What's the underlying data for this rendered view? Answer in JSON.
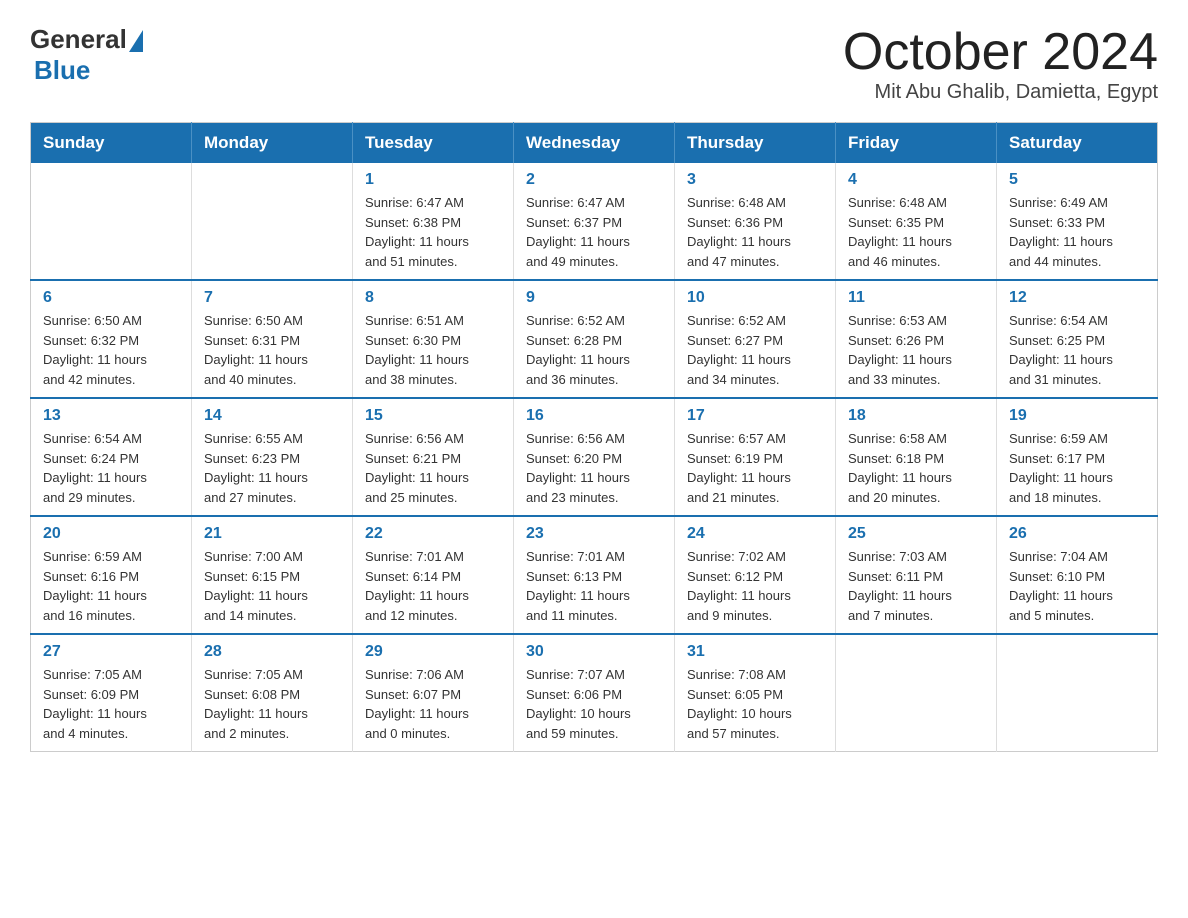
{
  "logo": {
    "general": "General",
    "blue": "Blue"
  },
  "header": {
    "month": "October 2024",
    "location": "Mit Abu Ghalib, Damietta, Egypt"
  },
  "weekdays": [
    "Sunday",
    "Monday",
    "Tuesday",
    "Wednesday",
    "Thursday",
    "Friday",
    "Saturday"
  ],
  "weeks": [
    [
      {
        "day": "",
        "info": ""
      },
      {
        "day": "",
        "info": ""
      },
      {
        "day": "1",
        "info": "Sunrise: 6:47 AM\nSunset: 6:38 PM\nDaylight: 11 hours\nand 51 minutes."
      },
      {
        "day": "2",
        "info": "Sunrise: 6:47 AM\nSunset: 6:37 PM\nDaylight: 11 hours\nand 49 minutes."
      },
      {
        "day": "3",
        "info": "Sunrise: 6:48 AM\nSunset: 6:36 PM\nDaylight: 11 hours\nand 47 minutes."
      },
      {
        "day": "4",
        "info": "Sunrise: 6:48 AM\nSunset: 6:35 PM\nDaylight: 11 hours\nand 46 minutes."
      },
      {
        "day": "5",
        "info": "Sunrise: 6:49 AM\nSunset: 6:33 PM\nDaylight: 11 hours\nand 44 minutes."
      }
    ],
    [
      {
        "day": "6",
        "info": "Sunrise: 6:50 AM\nSunset: 6:32 PM\nDaylight: 11 hours\nand 42 minutes."
      },
      {
        "day": "7",
        "info": "Sunrise: 6:50 AM\nSunset: 6:31 PM\nDaylight: 11 hours\nand 40 minutes."
      },
      {
        "day": "8",
        "info": "Sunrise: 6:51 AM\nSunset: 6:30 PM\nDaylight: 11 hours\nand 38 minutes."
      },
      {
        "day": "9",
        "info": "Sunrise: 6:52 AM\nSunset: 6:28 PM\nDaylight: 11 hours\nand 36 minutes."
      },
      {
        "day": "10",
        "info": "Sunrise: 6:52 AM\nSunset: 6:27 PM\nDaylight: 11 hours\nand 34 minutes."
      },
      {
        "day": "11",
        "info": "Sunrise: 6:53 AM\nSunset: 6:26 PM\nDaylight: 11 hours\nand 33 minutes."
      },
      {
        "day": "12",
        "info": "Sunrise: 6:54 AM\nSunset: 6:25 PM\nDaylight: 11 hours\nand 31 minutes."
      }
    ],
    [
      {
        "day": "13",
        "info": "Sunrise: 6:54 AM\nSunset: 6:24 PM\nDaylight: 11 hours\nand 29 minutes."
      },
      {
        "day": "14",
        "info": "Sunrise: 6:55 AM\nSunset: 6:23 PM\nDaylight: 11 hours\nand 27 minutes."
      },
      {
        "day": "15",
        "info": "Sunrise: 6:56 AM\nSunset: 6:21 PM\nDaylight: 11 hours\nand 25 minutes."
      },
      {
        "day": "16",
        "info": "Sunrise: 6:56 AM\nSunset: 6:20 PM\nDaylight: 11 hours\nand 23 minutes."
      },
      {
        "day": "17",
        "info": "Sunrise: 6:57 AM\nSunset: 6:19 PM\nDaylight: 11 hours\nand 21 minutes."
      },
      {
        "day": "18",
        "info": "Sunrise: 6:58 AM\nSunset: 6:18 PM\nDaylight: 11 hours\nand 20 minutes."
      },
      {
        "day": "19",
        "info": "Sunrise: 6:59 AM\nSunset: 6:17 PM\nDaylight: 11 hours\nand 18 minutes."
      }
    ],
    [
      {
        "day": "20",
        "info": "Sunrise: 6:59 AM\nSunset: 6:16 PM\nDaylight: 11 hours\nand 16 minutes."
      },
      {
        "day": "21",
        "info": "Sunrise: 7:00 AM\nSunset: 6:15 PM\nDaylight: 11 hours\nand 14 minutes."
      },
      {
        "day": "22",
        "info": "Sunrise: 7:01 AM\nSunset: 6:14 PM\nDaylight: 11 hours\nand 12 minutes."
      },
      {
        "day": "23",
        "info": "Sunrise: 7:01 AM\nSunset: 6:13 PM\nDaylight: 11 hours\nand 11 minutes."
      },
      {
        "day": "24",
        "info": "Sunrise: 7:02 AM\nSunset: 6:12 PM\nDaylight: 11 hours\nand 9 minutes."
      },
      {
        "day": "25",
        "info": "Sunrise: 7:03 AM\nSunset: 6:11 PM\nDaylight: 11 hours\nand 7 minutes."
      },
      {
        "day": "26",
        "info": "Sunrise: 7:04 AM\nSunset: 6:10 PM\nDaylight: 11 hours\nand 5 minutes."
      }
    ],
    [
      {
        "day": "27",
        "info": "Sunrise: 7:05 AM\nSunset: 6:09 PM\nDaylight: 11 hours\nand 4 minutes."
      },
      {
        "day": "28",
        "info": "Sunrise: 7:05 AM\nSunset: 6:08 PM\nDaylight: 11 hours\nand 2 minutes."
      },
      {
        "day": "29",
        "info": "Sunrise: 7:06 AM\nSunset: 6:07 PM\nDaylight: 11 hours\nand 0 minutes."
      },
      {
        "day": "30",
        "info": "Sunrise: 7:07 AM\nSunset: 6:06 PM\nDaylight: 10 hours\nand 59 minutes."
      },
      {
        "day": "31",
        "info": "Sunrise: 7:08 AM\nSunset: 6:05 PM\nDaylight: 10 hours\nand 57 minutes."
      },
      {
        "day": "",
        "info": ""
      },
      {
        "day": "",
        "info": ""
      }
    ]
  ]
}
